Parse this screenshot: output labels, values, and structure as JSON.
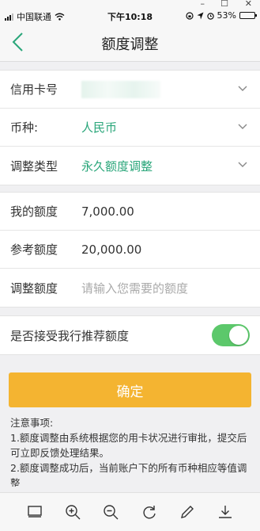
{
  "window": {
    "minimize": "–",
    "maximize": "☐",
    "close": "✕"
  },
  "status_bar": {
    "carrier": "中国联通",
    "time": "下午10:18",
    "battery_pct": "53%",
    "battery_level": 0.53
  },
  "nav": {
    "title": "额度调整"
  },
  "form": {
    "card_label": "信用卡号",
    "currency_label": "币种:",
    "currency_value": "人民币",
    "type_label": "调整类型",
    "type_value": "永久额度调整",
    "my_limit_label": "我的额度",
    "my_limit_value": "7,000.00",
    "ref_limit_label": "参考额度",
    "ref_limit_value": "20,000.00",
    "adjust_label": "调整额度",
    "adjust_placeholder": "请输入您需要的额度"
  },
  "recommend": {
    "label": "是否接受我行推荐额度",
    "enabled": true
  },
  "confirm_label": "确定",
  "notes": {
    "title": "注意事项:",
    "items": [
      "1.额度调整由系统根据您的用卡状况进行审批，提交后可立即反馈处理结果。",
      "2.额度调整成功后，当前账户下的所有币种相应等值调整"
    ]
  },
  "colors": {
    "accent_green": "#2aa67a",
    "button_orange": "#f4b431",
    "toggle_green": "#5cc86b"
  },
  "toolbar_icons": [
    "screen-icon",
    "zoom-in-icon",
    "zoom-out-icon",
    "rotate-icon",
    "edit-icon",
    "download-icon"
  ]
}
